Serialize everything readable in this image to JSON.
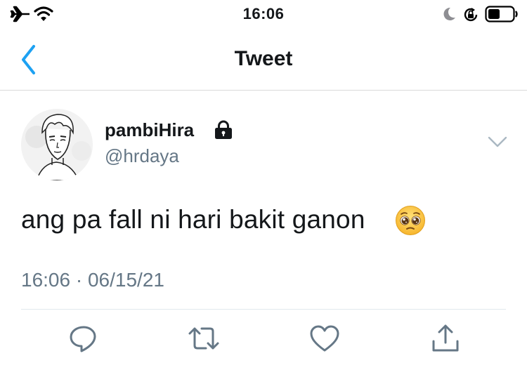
{
  "status_bar": {
    "time": "16:06",
    "icons": [
      "airplane-icon",
      "wifi-icon",
      "moon-icon",
      "orientation-lock-icon",
      "battery-icon"
    ]
  },
  "nav": {
    "title": "Tweet",
    "back_icon": "chevron-left-icon"
  },
  "tweet": {
    "display_name": "pambiHira",
    "username": "@hrdaya",
    "protected_icon": "lock-icon",
    "text": "ang pa fall ni hari bakit ganon",
    "emoji": "pleading-face",
    "time": "16:06",
    "separator": " · ",
    "date": "06/15/21"
  },
  "actions": [
    "reply-icon",
    "retweet-icon",
    "like-icon",
    "share-icon"
  ],
  "colors": {
    "accent": "#1da1f2",
    "text_primary": "#14171a",
    "text_secondary": "#657786",
    "icon_gray": "#657786",
    "divider": "#e1e8ed"
  }
}
